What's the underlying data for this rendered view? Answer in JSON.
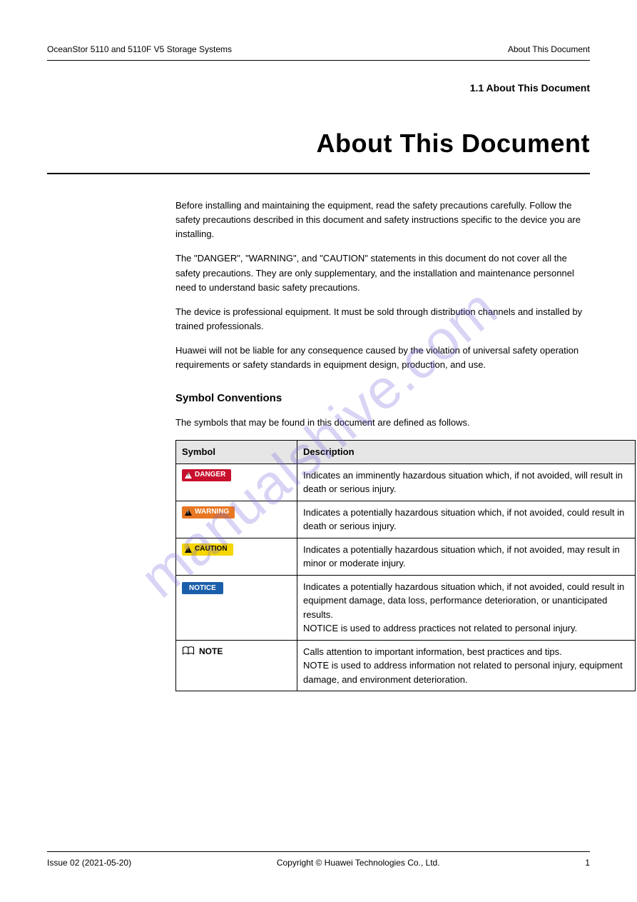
{
  "watermark": "manualshive.com",
  "header": {
    "left": "OceanStor 5110 and 5110F V5 Storage Systems",
    "right": "About This Document"
  },
  "sectionLabel": "1.1 About This Document",
  "mainTitle": "About This Document",
  "intro": {
    "p1": "Before installing and maintaining the equipment, read the safety precautions carefully. Follow the safety precautions described in this document and safety instructions specific to the device you are installing.",
    "p2": "The \"DANGER\", \"WARNING\", and \"CAUTION\" statements in this document do not cover all the safety precautions. They are only supplementary, and the installation and maintenance personnel need to understand basic safety precautions.",
    "p3": "The device is professional equipment. It must be sold through distribution channels and installed by trained professionals.",
    "p4": "Huawei will not be liable for any consequence caused by the violation of universal safety operation requirements or safety standards in equipment design, production, and use."
  },
  "symbolsHeading": "Symbol Conventions",
  "symbolsLead": "The symbols that may be found in this document are defined as follows.",
  "tableHeaders": {
    "symbol": "Symbol",
    "description": "Description"
  },
  "rows": {
    "danger": {
      "label": "DANGER",
      "desc": "Indicates an imminently hazardous situation which, if not avoided, will result in death or serious injury."
    },
    "warning": {
      "label": "WARNING",
      "desc": "Indicates a potentially hazardous situation which, if not avoided, could result in death or serious injury."
    },
    "caution": {
      "label": "CAUTION",
      "desc": "Indicates a potentially hazardous situation which, if not avoided, may result in minor or moderate injury."
    },
    "notice": {
      "label": "NOTICE",
      "desc": "Indicates a potentially hazardous situation which, if not avoided, could result in equipment damage, data loss, performance deterioration, or unanticipated results.\nNOTICE is used to address practices not related to personal injury."
    },
    "note": {
      "label": "NOTE",
      "desc": "Calls attention to important information, best practices and tips.\nNOTE is used to address information not related to personal injury, equipment damage, and environment deterioration."
    }
  },
  "footer": {
    "left": "Issue 02 (2021-05-20)",
    "center": "Copyright © Huawei Technologies Co., Ltd.",
    "right": "1"
  }
}
